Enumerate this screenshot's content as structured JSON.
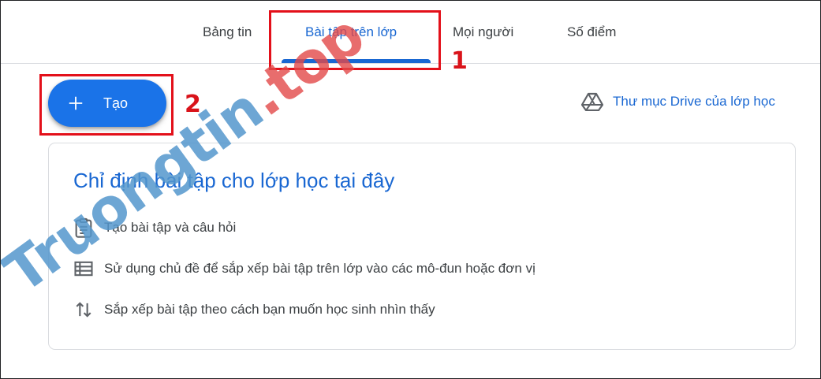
{
  "tabs": [
    {
      "label": "Bảng tin",
      "active": false
    },
    {
      "label": "Bài tập trên lớp",
      "active": true
    },
    {
      "label": "Mọi người",
      "active": false
    },
    {
      "label": "Số điểm",
      "active": false
    }
  ],
  "annotations": {
    "one": "1",
    "two": "2"
  },
  "create_button": {
    "label": "Tạo",
    "icon": "plus-icon"
  },
  "drive_link": {
    "label": "Thư mục Drive của lớp học",
    "icon": "drive-icon"
  },
  "card": {
    "title": "Chỉ định bài tập cho lớp học tại đây",
    "items": [
      {
        "icon": "assignment-icon",
        "text": "Tạo bài tập và câu hỏi"
      },
      {
        "icon": "topic-list-icon",
        "text": "Sử dụng chủ đề để sắp xếp bài tập trên lớp vào các mô-đun hoặc đơn vị"
      },
      {
        "icon": "reorder-icon",
        "text": "Sắp xếp bài tập theo cách bạn muốn học sinh nhìn thấy"
      }
    ]
  },
  "watermark": {
    "main": "Truongtin",
    "suffix": ".top"
  },
  "colors": {
    "accent": "#1967d2",
    "button": "#1a73e8",
    "annotation": "#e3101a"
  }
}
